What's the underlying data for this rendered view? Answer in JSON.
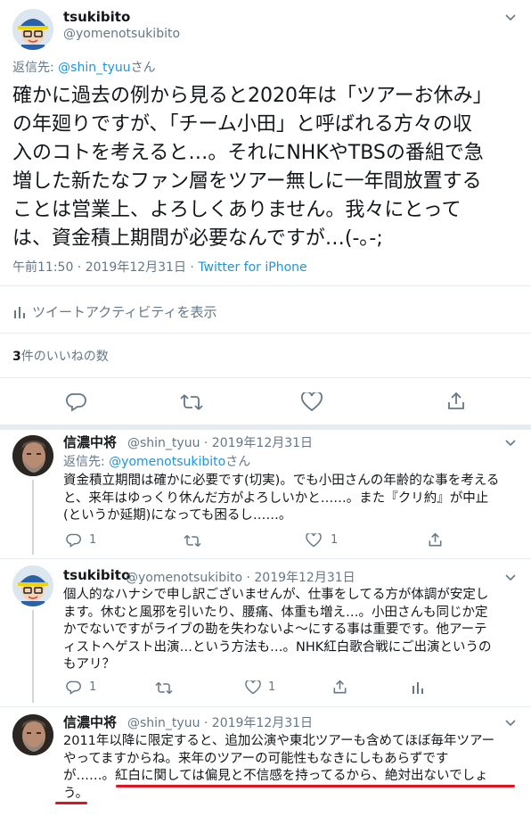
{
  "main_tweet": {
    "display_name": "tsukibito",
    "handle": "@yomenotsukibito",
    "reply_prefix": "返信先: ",
    "reply_to": "@shin_tyuu",
    "reply_suffix": "さん",
    "lines": [
      "確かに過去の例から見ると2020年は「ツアーお休み」",
      "の年廻りですが、「チーム小田」と呼ばれる方々の収",
      "入のコトを考えると…。それにNHKやTBSの番組で急",
      "増した新たなファン層をツアー無しに一年間放置する",
      "ことは営業上、よろしくありません。我々にとって",
      "は、資金積上期間が必要なんですが…(-｡-;"
    ],
    "time": "午前11:50 · 2019年12月31日 · ",
    "source": "Twitter for iPhone",
    "activity_label": "ツイートアクティビティを表示",
    "likes_count": "3",
    "likes_label": "件のいいねの数"
  },
  "replies": [
    {
      "display_name": "信濃中将",
      "handle": "@shin_tyuu · 2019年12月31日",
      "reply_prefix": "返信先: ",
      "reply_to": "@yomenotsukibito",
      "reply_suffix": "さん",
      "lines": [
        "資金積立期間は確かに必要です(切実)。でも小田さんの年齢的な事を考える",
        "と、来年はゆっくり休んだ方がよろしいかと……。また『クリ約』が中止",
        "(というか延期)になっても困るし……。"
      ],
      "reply_count": "1",
      "like_count": "1"
    },
    {
      "display_name": "tsukibito",
      "handle": "@yomenotsukibito · 2019年12月31日",
      "lines": [
        "個人的なハナシで申し訳ございませんが、仕事をしてる方が体調が安定し",
        "ます。休むと風邪を引いたり、腰痛、体重も増え…。小田さんも同じか定",
        "かでないですがライブの勘を失わないよ～にする事は重要です。他アーテ",
        "ィストへゲスト出演…という方法も…。NHK紅白歌合戦にご出演というの",
        "もアリ？"
      ],
      "reply_count": "1",
      "like_count": "1"
    },
    {
      "display_name": "信濃中将",
      "handle": "@shin_tyuu · 2019年12月31日",
      "lines": [
        "2011年以降に限定すると、追加公演や東北ツアーも含めてほぼ毎年ツアー",
        "やってますからね。来年のツアーの可能性もなきにしもあらずです",
        "が……。紅白に関しては偏見と不信感を持ってるから、絶対出ないでしょ",
        "う。"
      ]
    }
  ],
  "colors": {
    "link": "#1b95e0",
    "muted": "#657786",
    "text": "#14171a",
    "highlight_underline": "#e0141e"
  }
}
